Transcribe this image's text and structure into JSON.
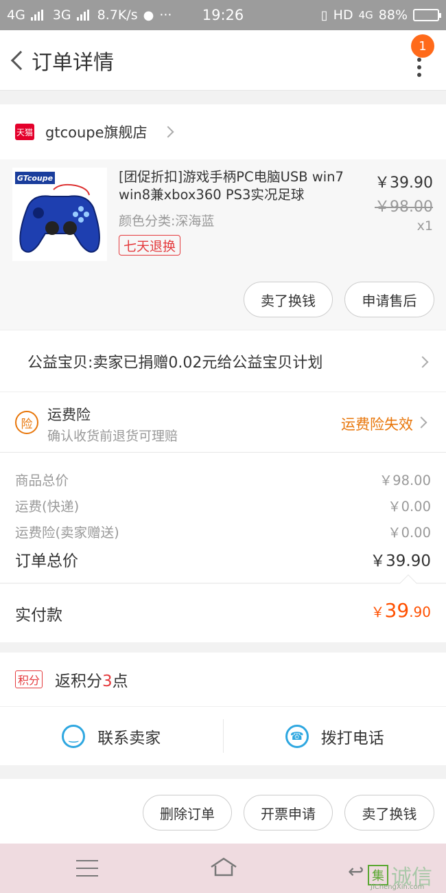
{
  "status_bar": {
    "net1": "4G",
    "net2": "3G",
    "speed": "8.7K/s",
    "dots": "···",
    "time": "19:26",
    "hd": "HD",
    "net3": "4G",
    "battery": "88%",
    "battery_level": 0.88
  },
  "header": {
    "title": "订单详情",
    "badge_count": "1"
  },
  "shop": {
    "badge": "天猫",
    "name": "gtcoupe旗舰店"
  },
  "product": {
    "brand_logo": "GTcoupe",
    "title": "[团促折扣]游戏手柄PC电脑USB win7 win8兼xbox360 PS3实况足球",
    "spec": "颜色分类:深海蓝",
    "tag": "七天退换",
    "price": "￥39.90",
    "original_price": "￥98.00",
    "quantity": "x1",
    "btn_sell": "卖了换钱",
    "btn_after_sale": "申请售后"
  },
  "charity": {
    "text": "公益宝贝:卖家已捐赠0.02元给公益宝贝计划"
  },
  "insurance": {
    "icon_text": "险",
    "title": "运费险",
    "subtitle": "确认收货前退货可理赔",
    "status": "运费险失效"
  },
  "summary": {
    "rows": [
      {
        "label": "商品总价",
        "value": "￥98.00"
      },
      {
        "label": "运费(快递)",
        "value": "￥0.00"
      },
      {
        "label": "运费险(卖家赠送)",
        "value": "￥0.00"
      }
    ],
    "total_label": "订单总价",
    "total_value": "￥39.90"
  },
  "paid": {
    "label": "实付款",
    "symbol": "￥",
    "int": "39",
    "dec": ".90"
  },
  "points": {
    "tag": "积分",
    "prefix": "返积分",
    "num": "3",
    "suffix": "点"
  },
  "contact": {
    "seller": "联系卖家",
    "phone": "拨打电话"
  },
  "actions": {
    "delete": "删除订单",
    "invoice": "开票申请",
    "sell": "卖了换钱"
  },
  "watermark": {
    "mark": "集",
    "text": "诚信",
    "url": "JiChengXin.com"
  },
  "colors": {
    "accent_orange": "#ff5000",
    "tmall_red": "#e4002b",
    "insurance_orange": "#e8760a",
    "contact_blue": "#2ea7e0"
  }
}
